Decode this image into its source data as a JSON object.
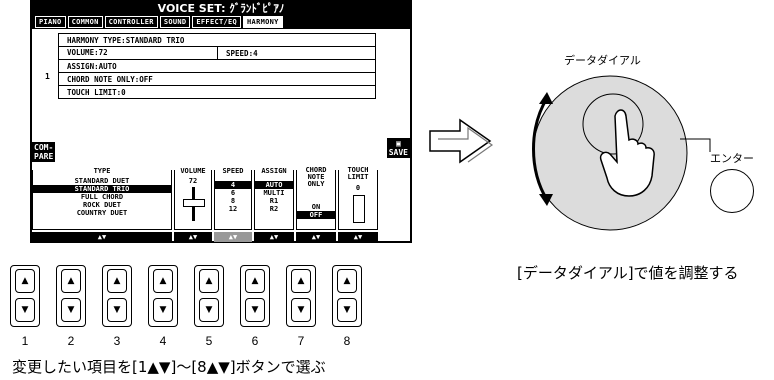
{
  "lcd": {
    "title": "VOICE SET: ｸﾞﾗﾝﾄﾞﾋﾟｱﾉ",
    "tabs": [
      "PIANO",
      "COMMON",
      "CONTROLLER",
      "SOUND",
      "EFFECT/EQ",
      "HARMONY"
    ],
    "active_tab": "HARMONY",
    "row_number": "1",
    "rows": [
      {
        "left": "HARMONY TYPE:STANDARD TRIO",
        "right": ""
      },
      {
        "left": "VOLUME:72",
        "right": "SPEED:4"
      },
      {
        "left": "ASSIGN:AUTO",
        "right": ""
      },
      {
        "left": "CHORD NOTE ONLY:OFF",
        "right": ""
      },
      {
        "left": "TOUCH LIMIT:0",
        "right": ""
      }
    ],
    "compare_label_1": "COM-",
    "compare_label_2": "PARE",
    "save_label": "SAVE",
    "params": {
      "type": {
        "title": "TYPE",
        "options": [
          "STANDARD DUET",
          "STANDARD TRIO",
          "FULL CHORD",
          "ROCK DUET",
          "COUNTRY DUET"
        ],
        "selected": "STANDARD TRIO"
      },
      "volume": {
        "title": "VOLUME",
        "value": "72"
      },
      "speed": {
        "title": "SPEED",
        "options": [
          "4",
          "6",
          "8",
          "12"
        ],
        "selected": "4"
      },
      "assign": {
        "title": "ASSIGN",
        "options": [
          "AUTO",
          "MULTI",
          "R1",
          "R2"
        ],
        "selected": "AUTO"
      },
      "chord": {
        "title_1": "CHORD",
        "title_2": "NOTE",
        "title_3": "ONLY",
        "options": [
          "ON",
          "OFF"
        ],
        "selected": "OFF"
      },
      "touch": {
        "title_1": "TOUCH",
        "title_2": "LIMIT",
        "value": "0"
      }
    }
  },
  "buttons": {
    "up_glyph": "▲",
    "down_glyph": "▼",
    "numbers": [
      "1",
      "2",
      "3",
      "4",
      "5",
      "6",
      "7",
      "8"
    ]
  },
  "dial": {
    "label": "データダイアル",
    "enter_label": "エンター"
  },
  "captions": {
    "buttons": "変更したい項目を[1▲▼]〜[8▲▼]ボタンで選ぶ",
    "dial": "[データダイアル]で値を調整する"
  }
}
